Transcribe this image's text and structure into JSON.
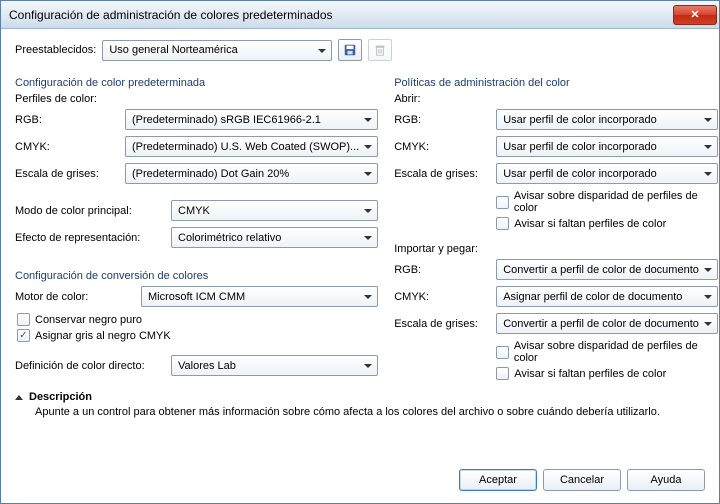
{
  "title": "Configuración de administración de colores predeterminados",
  "preset": {
    "label": "Preestablecidos:",
    "value": "Uso general Norteamérica"
  },
  "left": {
    "groupTitle": "Configuración de color predeterminada",
    "profilesLabel": "Perfiles de color:",
    "rgbLabel": "RGB:",
    "rgbValue": "(Predeterminado) sRGB IEC61966-2.1",
    "cmykLabel": "CMYK:",
    "cmykValue": "(Predeterminado) U.S. Web Coated (SWOP)...",
    "grayLabel": "Escala de grises:",
    "grayValue": "(Predeterminado) Dot Gain 20%",
    "modeLabel": "Modo de color principal:",
    "modeValue": "CMYK",
    "intentLabel": "Efecto de representación:",
    "intentValue": "Colorimétrico relativo",
    "convGroup": "Configuración de conversión de colores",
    "engineLabel": "Motor de color:",
    "engineValue": "Microsoft ICM CMM",
    "preserveBlack": "Conservar negro puro",
    "mapGray": "Asignar gris al negro CMYK",
    "spotLabel": "Definición de color directo:",
    "spotValue": "Valores Lab"
  },
  "right": {
    "groupTitle": "Políticas de administración del color",
    "openLabel": "Abrir:",
    "rgbLabel": "RGB:",
    "rgbValue": "Usar perfil de color incorporado",
    "cmykLabel": "CMYK:",
    "cmykValue": "Usar perfil de color incorporado",
    "grayLabel": "Escala de grises:",
    "grayValue": "Usar perfil de color incorporado",
    "warnMismatch": "Avisar sobre disparidad de perfiles de color",
    "warnMissing": "Avisar si faltan perfiles de color",
    "importLabel": "Importar y pegar:",
    "iRgbValue": "Convertir a perfil de color de documento",
    "iCmykValue": "Asignar perfil de color de documento",
    "iGrayValue": "Convertir a perfil de color de documento"
  },
  "desc": {
    "title": "Descripción",
    "text": "Apunte a un control para obtener más información sobre cómo afecta a los colores del archivo o sobre cuándo debería utilizarlo."
  },
  "buttons": {
    "ok": "Aceptar",
    "cancel": "Cancelar",
    "help": "Ayuda"
  }
}
